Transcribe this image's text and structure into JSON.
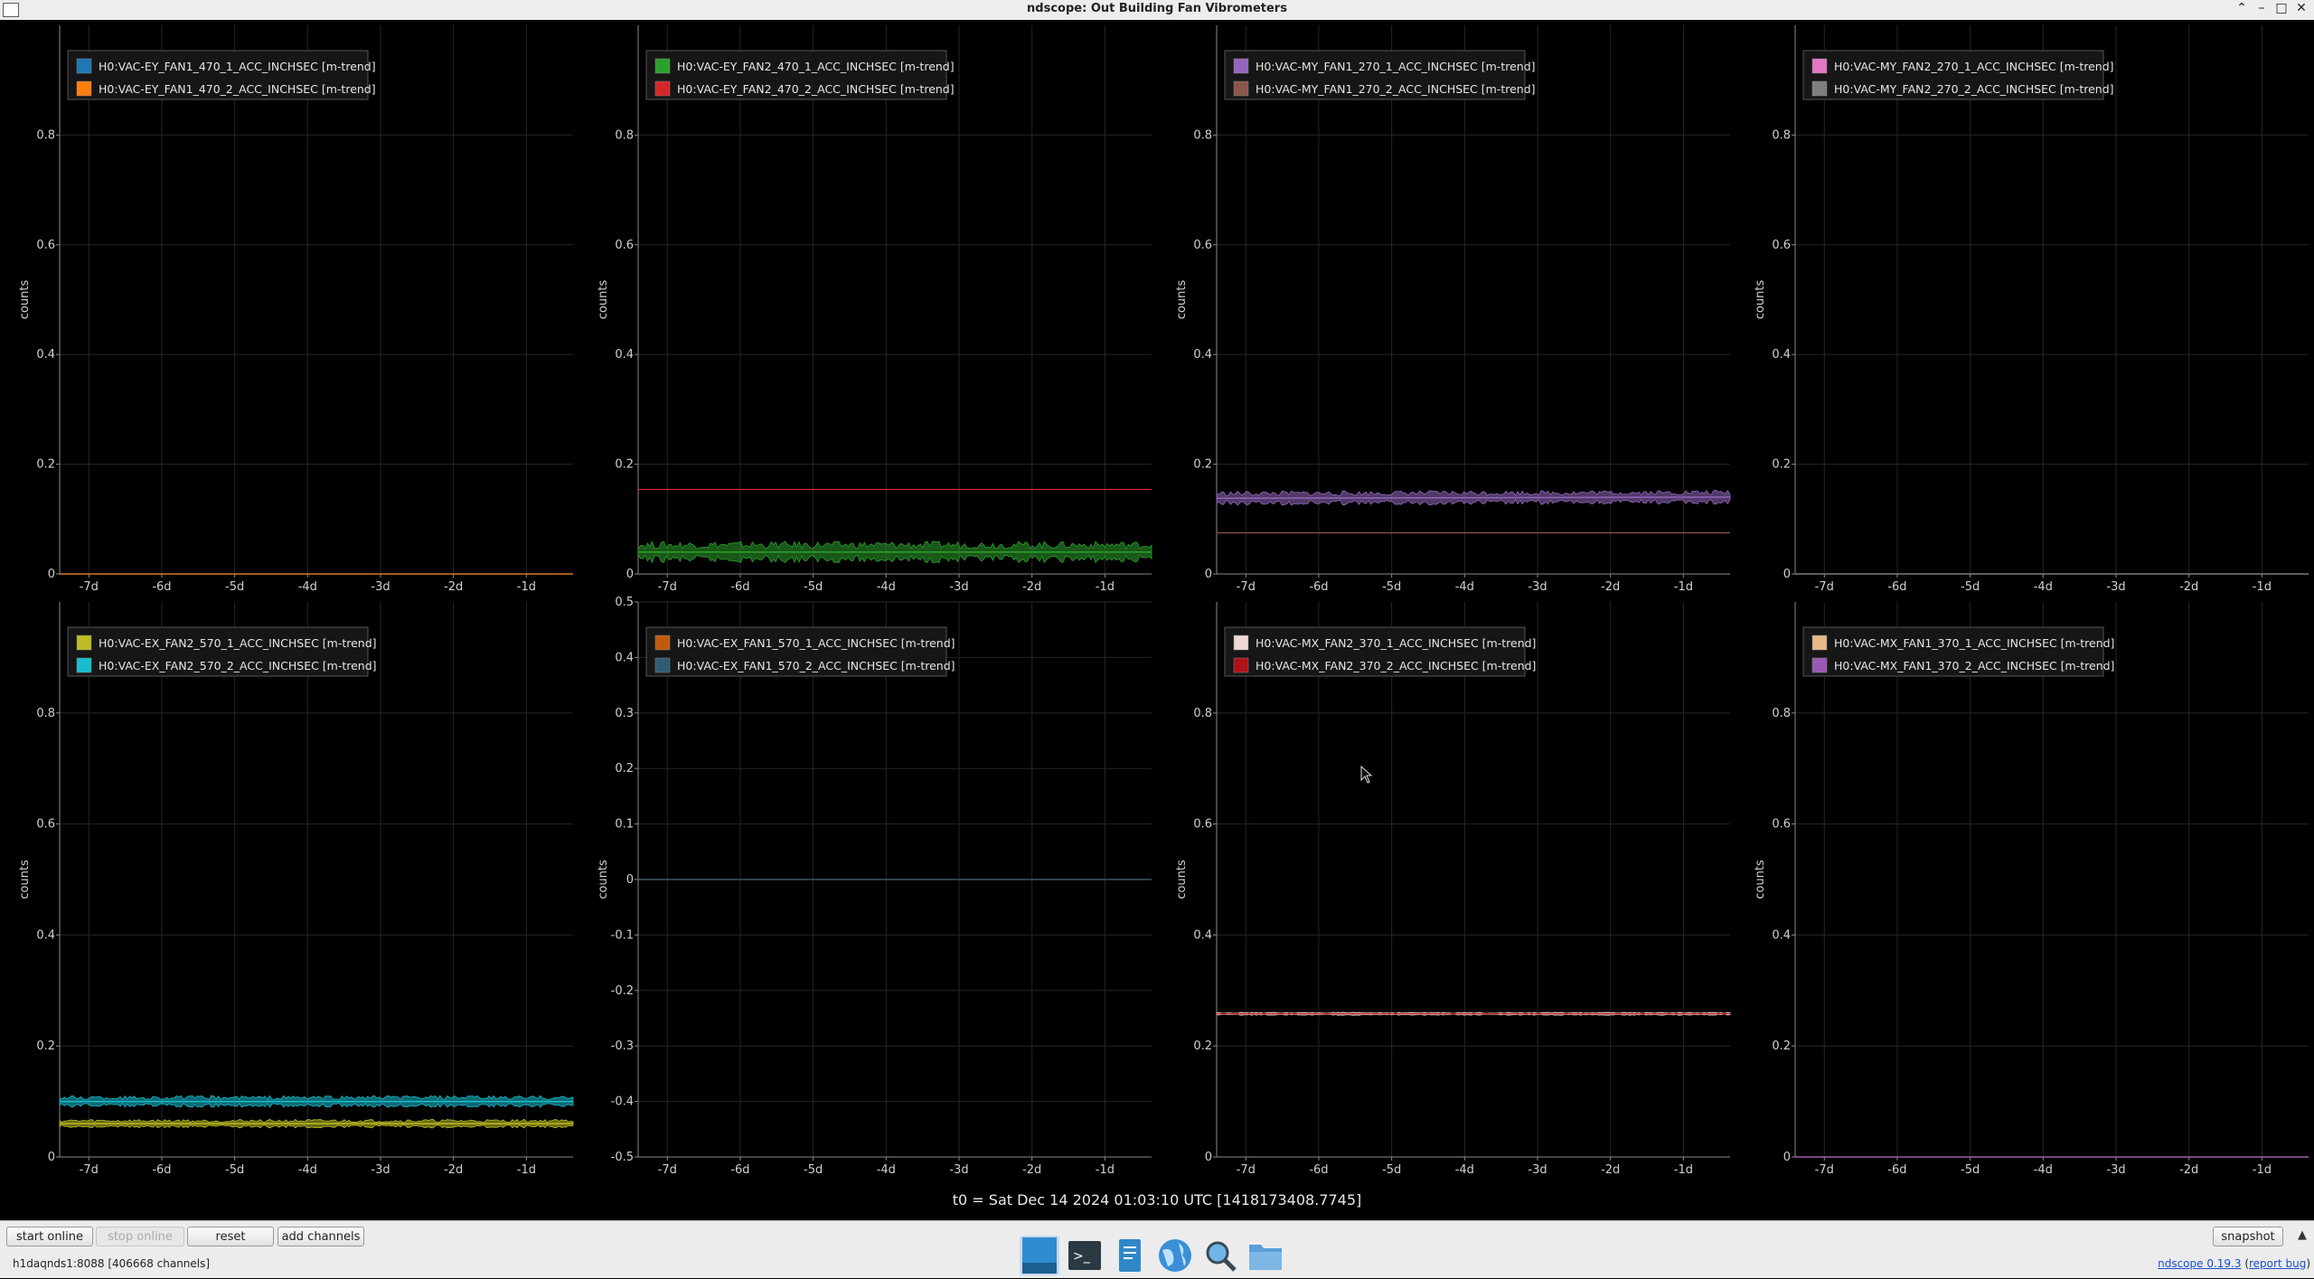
{
  "window": {
    "title": "ndscope: Out Building Fan Vibrometers"
  },
  "colors": {
    "background": "#000000",
    "grid": "#262626",
    "axis": "#8a8a8a",
    "text": "#d0d0d0",
    "legend_bg": "#161616",
    "legend_border": "#555555"
  },
  "plots": [
    {
      "ylabel": "counts",
      "ylim": [
        0,
        1
      ],
      "yticks": [
        0,
        0.2,
        0.4,
        0.6,
        0.8
      ],
      "series": [
        {
          "name": "H0:VAC-EY_FAN1_470_1_ACC_INCHSEC [m-trend]",
          "color": "#1f77b4",
          "values": [
            0,
            0
          ]
        },
        {
          "name": "H0:VAC-EY_FAN1_470_2_ACC_INCHSEC [m-trend]",
          "color": "#ff7f0e",
          "values": [
            0,
            0
          ]
        }
      ]
    },
    {
      "ylabel": "counts",
      "ylim": [
        0,
        1
      ],
      "yticks": [
        0,
        0.2,
        0.4,
        0.6,
        0.8
      ],
      "series": [
        {
          "name": "H0:VAC-EY_FAN2_470_1_ACC_INCHSEC [m-trend]",
          "color": "#2ca02c",
          "values": [
            0.04,
            0.04
          ],
          "band": 0.015
        },
        {
          "name": "H0:VAC-EY_FAN2_470_2_ACC_INCHSEC [m-trend]",
          "color": "#d62728",
          "values": [
            0.154,
            0.154
          ]
        }
      ]
    },
    {
      "ylabel": "counts",
      "ylim": [
        0,
        1
      ],
      "yticks": [
        0,
        0.2,
        0.4,
        0.6,
        0.8
      ],
      "series": [
        {
          "name": "H0:VAC-MY_FAN1_270_1_ACC_INCHSEC [m-trend]",
          "color": "#9467bd",
          "values": [
            0.138,
            0.14
          ],
          "band": 0.01
        },
        {
          "name": "H0:VAC-MY_FAN1_270_2_ACC_INCHSEC [m-trend]",
          "color": "#8c564b",
          "values": [
            0.075,
            0.075
          ]
        }
      ]
    },
    {
      "ylabel": "counts",
      "ylim": [
        0,
        1
      ],
      "yticks": [
        0,
        0.2,
        0.4,
        0.6,
        0.8
      ],
      "series": [
        {
          "name": "H0:VAC-MY_FAN2_270_1_ACC_INCHSEC [m-trend]",
          "color": "#e377c2",
          "values": [
            0,
            0
          ]
        },
        {
          "name": "H0:VAC-MY_FAN2_270_2_ACC_INCHSEC [m-trend]",
          "color": "#7f7f7f",
          "values": [
            0,
            0
          ]
        }
      ]
    },
    {
      "ylabel": "counts",
      "ylim": [
        0,
        1
      ],
      "yticks": [
        0,
        0.2,
        0.4,
        0.6,
        0.8
      ],
      "series": [
        {
          "name": "H0:VAC-EX_FAN2_570_1_ACC_INCHSEC [m-trend]",
          "color": "#bcbd22",
          "values": [
            0.06,
            0.06
          ],
          "band": 0.006
        },
        {
          "name": "H0:VAC-EX_FAN2_570_2_ACC_INCHSEC [m-trend]",
          "color": "#17becf",
          "values": [
            0.1,
            0.1
          ],
          "band": 0.008
        }
      ]
    },
    {
      "ylabel": "counts",
      "ylim": [
        -0.5,
        0.5
      ],
      "yticks": [
        -0.5,
        -0.4,
        -0.3,
        -0.2,
        -0.1,
        0,
        0.1,
        0.2,
        0.3,
        0.4,
        0.5
      ],
      "series": [
        {
          "name": "H0:VAC-EX_FAN1_570_1_ACC_INCHSEC [m-trend]",
          "color": "#c25a0c",
          "values": [
            0,
            0
          ]
        },
        {
          "name": "H0:VAC-EX_FAN1_570_2_ACC_INCHSEC [m-trend]",
          "color": "#2f5c73",
          "values": [
            0,
            0
          ]
        }
      ]
    },
    {
      "ylabel": "counts",
      "ylim": [
        0,
        1
      ],
      "yticks": [
        0,
        0.2,
        0.4,
        0.6,
        0.8
      ],
      "series": [
        {
          "name": "H0:VAC-MX_FAN2_370_1_ACC_INCHSEC [m-trend]",
          "color": "#f0d8d6",
          "values": [
            0.258,
            0.258
          ],
          "band": 0.002
        },
        {
          "name": "H0:VAC-MX_FAN2_370_2_ACC_INCHSEC [m-trend]",
          "color": "#b01217",
          "values": [
            0.258,
            0.258
          ]
        }
      ]
    },
    {
      "ylabel": "counts",
      "ylim": [
        0,
        1
      ],
      "yticks": [
        0,
        0.2,
        0.4,
        0.6,
        0.8
      ],
      "series": [
        {
          "name": "H0:VAC-MX_FAN1_370_1_ACC_INCHSEC [m-trend]",
          "color": "#e6b98c",
          "values": [
            0,
            0
          ]
        },
        {
          "name": "H0:VAC-MX_FAN1_370_2_ACC_INCHSEC [m-trend]",
          "color": "#9b59b6",
          "values": [
            0,
            0
          ]
        }
      ]
    }
  ],
  "xaxis": {
    "ticks": [
      -7,
      -6,
      -5,
      -4,
      -3,
      -2,
      -1
    ],
    "tick_labels": [
      "-7d",
      "-6d",
      "-5d",
      "-4d",
      "-3d",
      "-2d",
      "-1d"
    ],
    "xlim": [
      -7.4,
      -0.36
    ]
  },
  "t0": "t0 = Sat Dec 14 2024 01:03:10 UTC [1418173408.7745]",
  "toolbar": {
    "start_online": "start online",
    "stop_online": "stop online",
    "reset": "reset",
    "add_channels": "add channels",
    "snapshot": "snapshot"
  },
  "status": {
    "server": "h1daqnds1:8088  [406668 channels]",
    "version_link": "ndscope 0.19.3",
    "report_bug": "report bug"
  },
  "taskbar": {
    "items": [
      "show-desktop-icon",
      "terminal-icon",
      "text-editor-icon",
      "web-browser-icon",
      "search-icon",
      "file-manager-icon"
    ]
  }
}
